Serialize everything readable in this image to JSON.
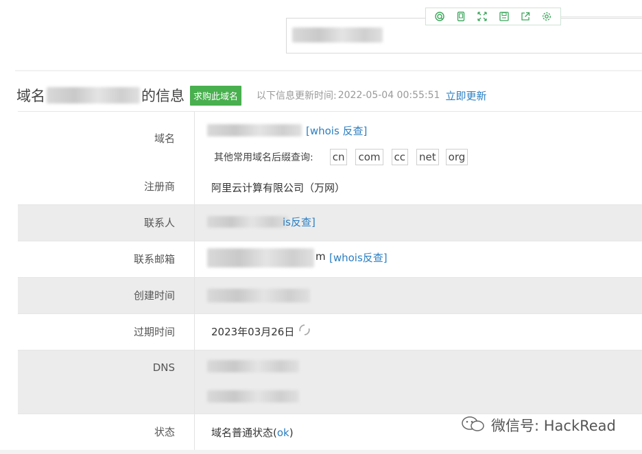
{
  "toolbar": {
    "icons": [
      "search-icon",
      "mobile-icon",
      "fullscreen-icon",
      "save-icon",
      "share-icon",
      "settings-icon"
    ]
  },
  "header": {
    "title_prefix": "域名",
    "title_suffix": "的信息",
    "buy_button": "求购此域名",
    "update_label": "以下信息更新时间:",
    "update_time": "2022-05-04 00:55:51",
    "update_link": "立即更新"
  },
  "table": {
    "domain_label": "域名",
    "whois_reverse": "[whois 反查]",
    "suffix_label": "其他常用域名后缀查询:",
    "suffixes": [
      "cn",
      "com",
      "cc",
      "net",
      "org"
    ],
    "registrar_label": "注册商",
    "registrar_value": "阿里云计算有限公司（万网）",
    "contact_label": "联系人",
    "contact_link": "is反查]",
    "email_label": "联系邮箱",
    "email_tail": "m",
    "email_link": "[whois反查]",
    "created_label": "创建时间",
    "expire_label": "过期时间",
    "expire_value": "2023年03月26日",
    "dns_label": "DNS",
    "status_label": "状态",
    "status_prefix": "域名普通状态(",
    "status_ok": "ok",
    "status_suffix": ")"
  },
  "watermark": {
    "text": "微信号: HackRead"
  }
}
